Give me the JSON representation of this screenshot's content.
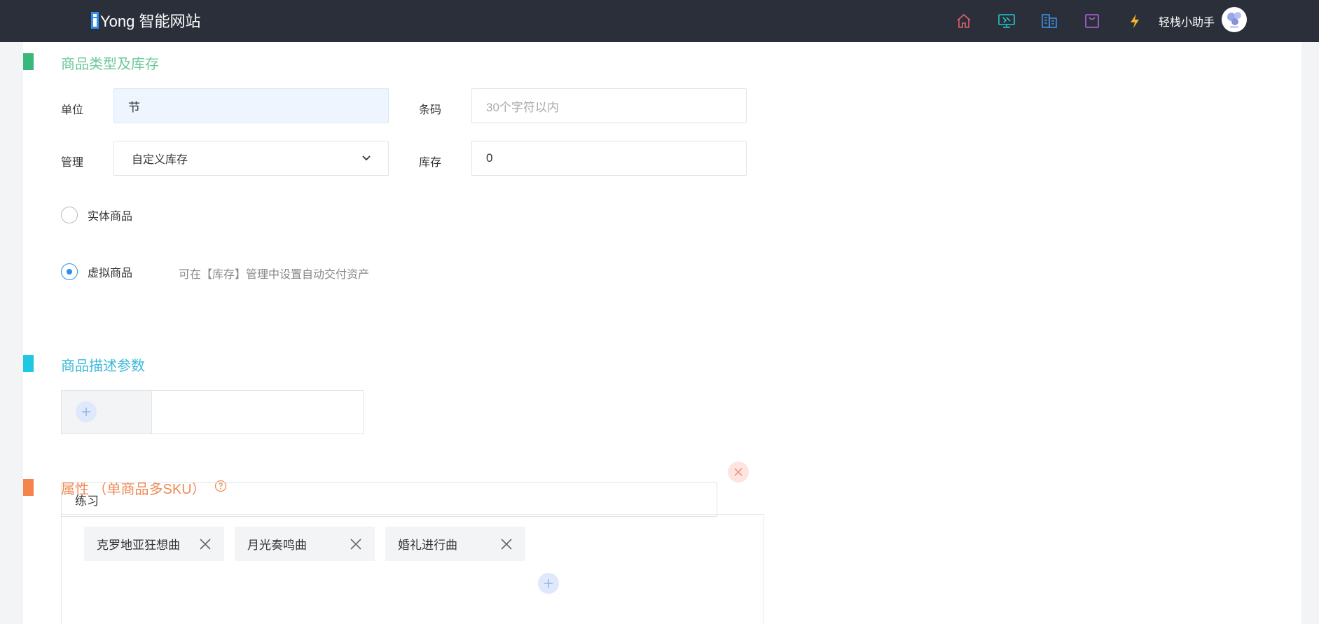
{
  "header": {
    "logo_text": "Yong 智能网站",
    "user_name": "轻栈小助手",
    "icons": [
      "home-icon",
      "monitor-icon",
      "building-icon",
      "bag-icon",
      "lightning-icon"
    ]
  },
  "colors": {
    "green": "#3ab77a",
    "cyan": "#1ec8e0",
    "orange": "#f5844c",
    "blue": "#2d8ff0"
  },
  "stock_section": {
    "title": "商品类型及库存",
    "unit_label": "单位",
    "unit_value": "节",
    "barcode_label": "条码",
    "barcode_placeholder": "30个字符以内",
    "manage_label": "管理",
    "manage_selected": "自定义库存",
    "stock_label": "库存",
    "stock_value": "0",
    "physical_label": "实体商品",
    "virtual_label": "虚拟商品",
    "virtual_hint": "可在【库存】管理中设置自动交付资产",
    "selected_type": "虚拟商品"
  },
  "desc_section": {
    "title": "商品描述参数"
  },
  "attr_section": {
    "title": "属性 （单商品多SKU）",
    "attr_name": "练习",
    "values": [
      "克罗地亚狂想曲",
      "月光奏鸣曲",
      "婚礼进行曲"
    ]
  }
}
